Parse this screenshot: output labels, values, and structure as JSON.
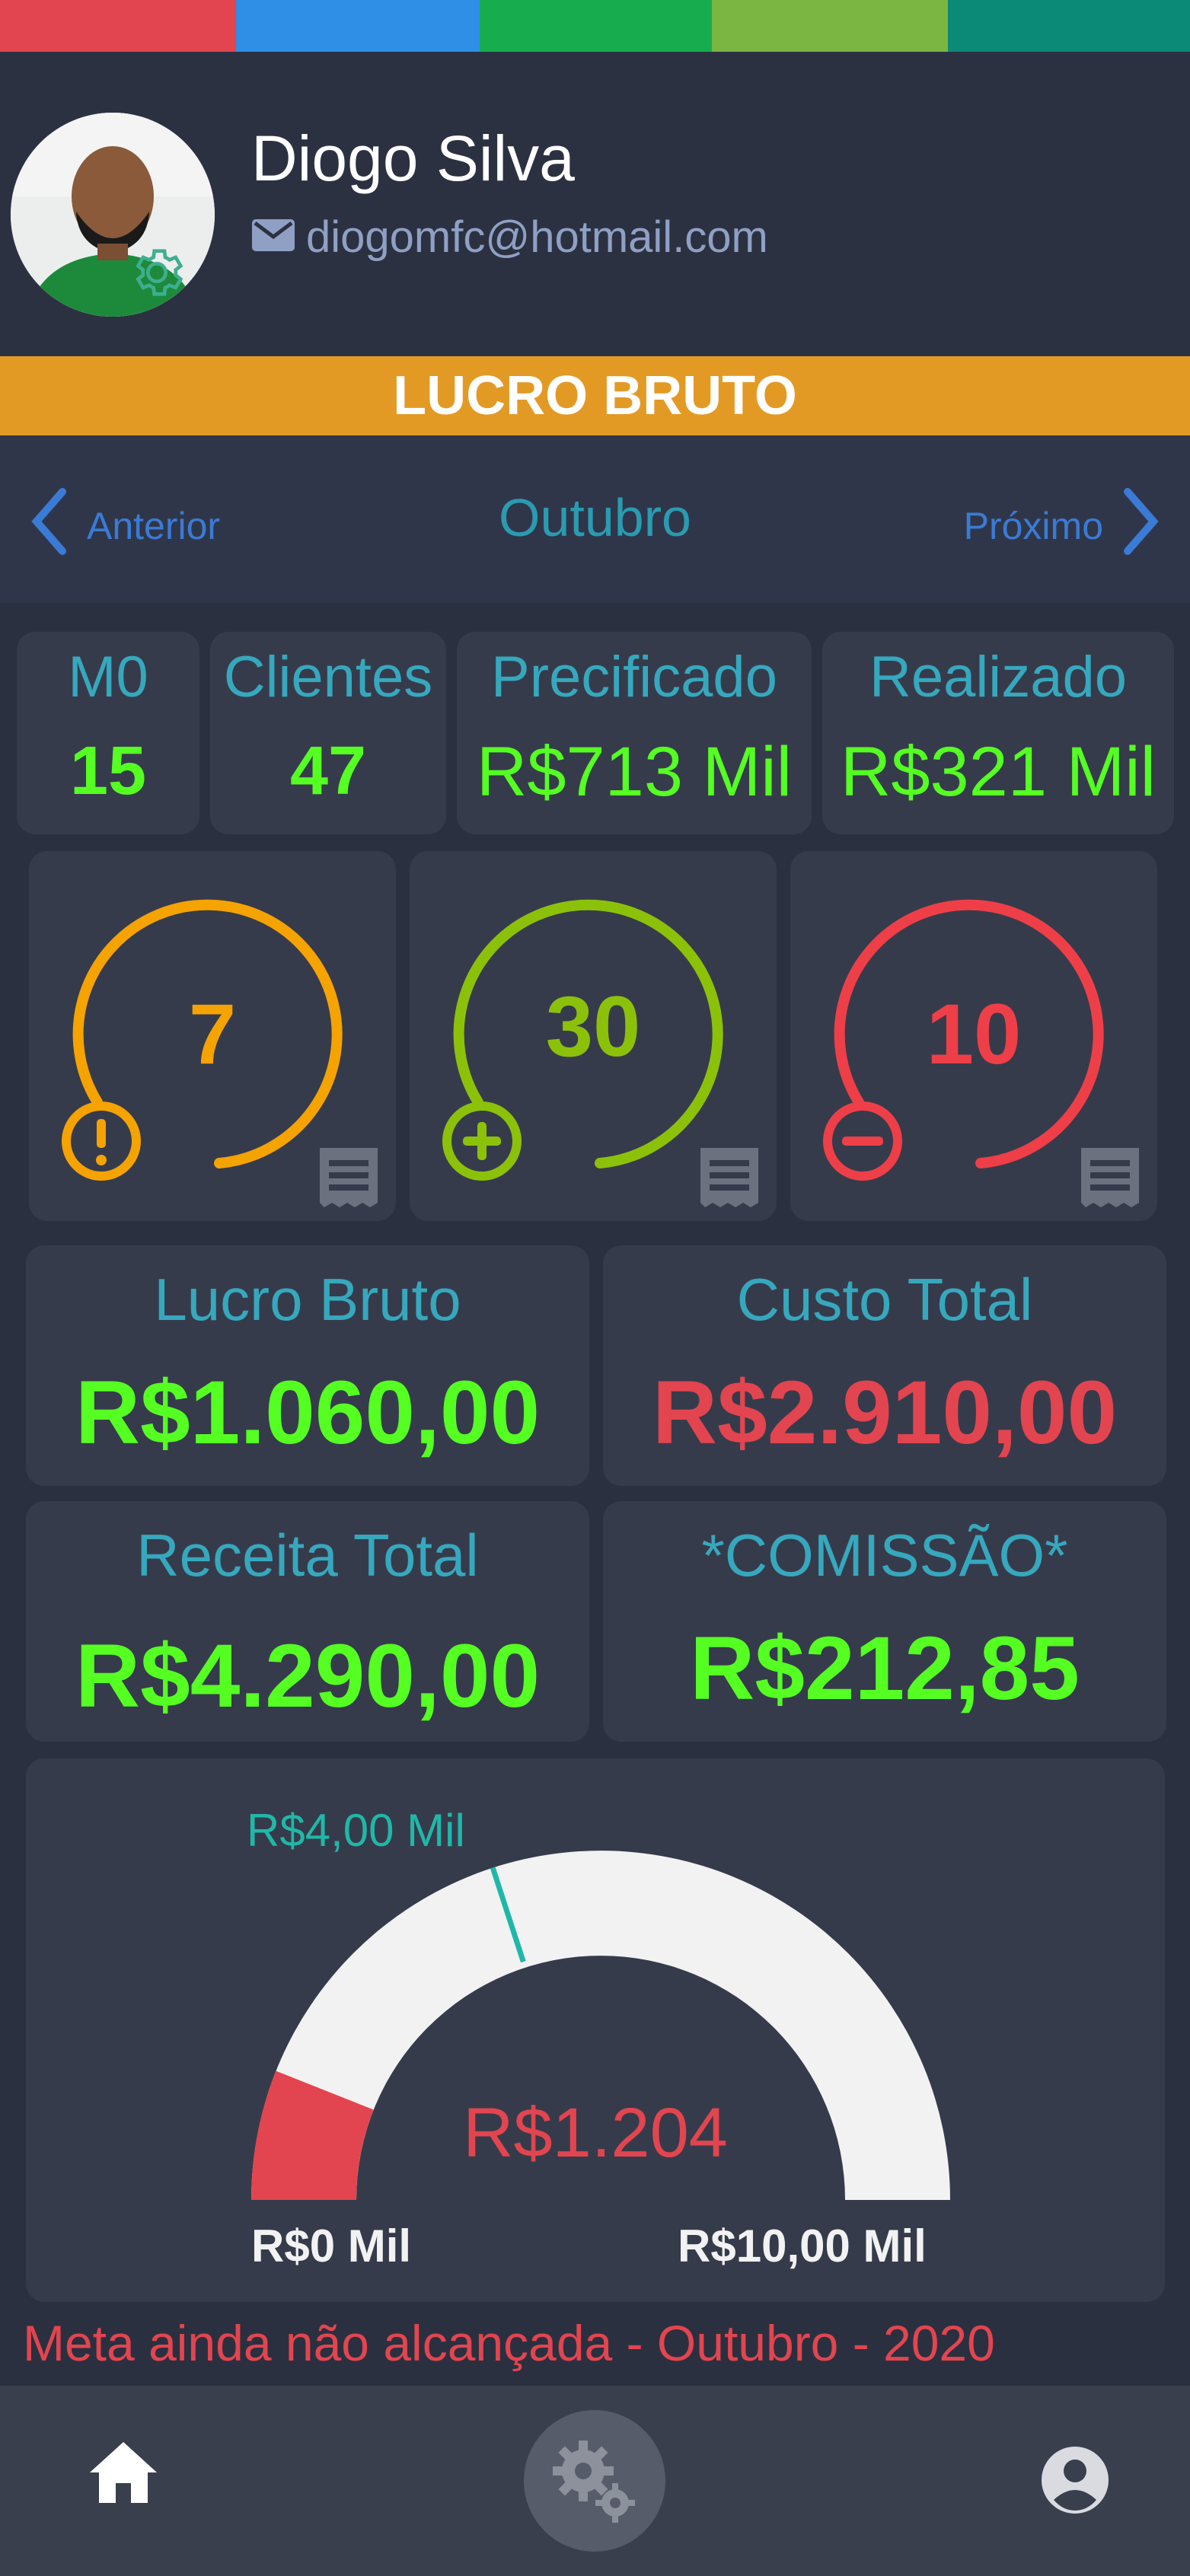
{
  "header": {
    "user_name": "Diogo Silva",
    "user_email": "diogomfc@hotmail.com"
  },
  "banner": {
    "title": "LUCRO BRUTO"
  },
  "nav": {
    "prev_label": "Anterior",
    "month": "Outubro",
    "next_label": "Próximo"
  },
  "stats": [
    {
      "label": "M0",
      "value": "15"
    },
    {
      "label": "Clientes",
      "value": "47"
    },
    {
      "label": "Precificado",
      "value": "R$713 Mil"
    },
    {
      "label": "Realizado",
      "value": "R$321 Mil"
    }
  ],
  "status_cards": [
    {
      "value": "7",
      "color": "#f5a300",
      "icon": "alert-icon"
    },
    {
      "value": "30",
      "color": "#8cc10a",
      "icon": "plus-icon"
    },
    {
      "value": "10",
      "color": "#ee3f48",
      "icon": "minus-icon"
    }
  ],
  "financials": {
    "lucro_bruto": {
      "label": "Lucro Bruto",
      "value": "R$1.060,00",
      "color": "#55ff22"
    },
    "custo_total": {
      "label": "Custo Total",
      "value": "R$2.910,00",
      "color": "#e2454f"
    },
    "receita_total": {
      "label": "Receita Total",
      "value": "R$4.290,00",
      "color": "#55ff22"
    },
    "comissao": {
      "label": "*COMISSÃO*",
      "value": "R$212,85",
      "color": "#55ff22"
    }
  },
  "gauge": {
    "target_label": "R$4,00 Mil",
    "current_value": "R$1.204",
    "min_label": "R$0 Mil",
    "max_label": "R$10,00 Mil",
    "current": 1204,
    "target": 4000,
    "min": 0,
    "max": 10000,
    "fill_color": "#e2454f",
    "target_color": "#1fb8a8"
  },
  "status_message": "Meta ainda não alcançada - Outubro - 2020",
  "colors": {
    "strip": [
      "#e2454f",
      "#2f8ee5",
      "#17ad4f",
      "#7bb542",
      "#0b8a78"
    ],
    "accent_teal": "#36a8be",
    "positive": "#55ff22",
    "negative": "#e2454f",
    "banner": "#e39a25"
  },
  "bottom_nav": {
    "home_icon": "home-icon",
    "settings_icon": "gears-icon",
    "profile_icon": "account-icon"
  }
}
